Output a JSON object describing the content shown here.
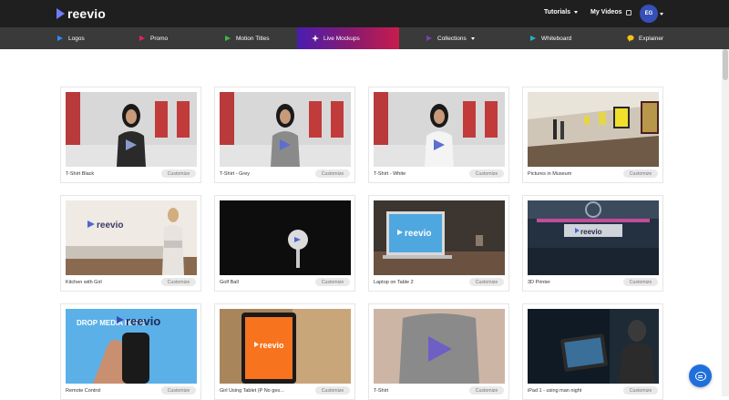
{
  "brand": {
    "name": "reevio"
  },
  "topnav": {
    "tutorials": "Tutorials",
    "my_videos": "My Videos",
    "avatar_initials": "EG"
  },
  "categories": [
    {
      "label": "Logos",
      "icon": "logos-icon",
      "color": "#2f8cff"
    },
    {
      "label": "Promo",
      "icon": "promo-icon",
      "color": "#e0245e"
    },
    {
      "label": "Motion Titles",
      "icon": "motion-titles-icon",
      "color": "#3bb84a"
    },
    {
      "label": "Live Mockups",
      "icon": "live-mockups-icon",
      "color": "#ffffff",
      "active": true
    },
    {
      "label": "Collections",
      "icon": "collections-icon",
      "color": "#7a3fb8"
    },
    {
      "label": "Whiteboard",
      "icon": "whiteboard-icon",
      "color": "#22b3c7"
    },
    {
      "label": "Explainer",
      "icon": "explainer-icon",
      "color": "#f3c316"
    }
  ],
  "templates": [
    {
      "title": "T-Shirt Black",
      "button": "Customize"
    },
    {
      "title": "T-Shirt - Grey",
      "button": "Customize"
    },
    {
      "title": "T-Shirt - White",
      "button": "Customize"
    },
    {
      "title": "Pictures in Museum",
      "button": "Customize"
    },
    {
      "title": "Kitchen with Girl",
      "button": "Customize"
    },
    {
      "title": "Golf Ball",
      "button": "Customize"
    },
    {
      "title": "Laptop on Table 2",
      "button": "Customize"
    },
    {
      "title": "3D Printer",
      "button": "Customize"
    },
    {
      "title": "Remote Control",
      "button": "Customize"
    },
    {
      "title": "Girl Using Tablet (P No ges...",
      "button": "Customize"
    },
    {
      "title": "T-Shirt",
      "button": "Customize"
    },
    {
      "title": "iPad 1 - using man night",
      "button": "Customize"
    }
  ],
  "thumb_text": {
    "reevio": "reevio",
    "drop_media": "DROP MEDIA HERE"
  },
  "chat_icon": "chat-icon"
}
